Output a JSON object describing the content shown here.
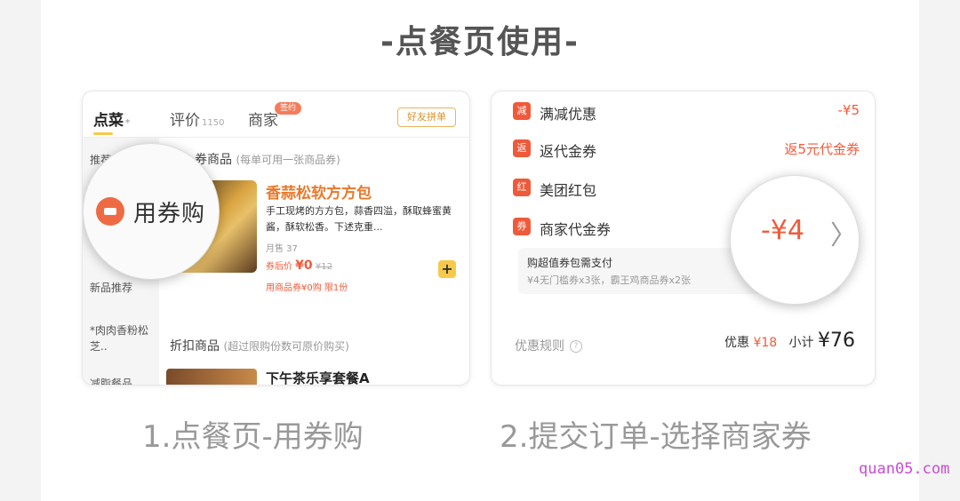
{
  "heading": "-点餐页使用-",
  "card1": {
    "tabs": [
      {
        "label": "点菜",
        "suffix": "*"
      },
      {
        "label": "评价",
        "count": "1150"
      },
      {
        "label": "商家",
        "badge": "签约"
      }
    ],
    "friend_button": "好友拼单",
    "sidebar": [
      "推荐",
      "新品推荐",
      "*肉肉香粉松芝..",
      "减脂餐品"
    ],
    "coupon_section": {
      "title": "券商品",
      "note": "(每单可用一张商品券)"
    },
    "magnifier_label": "用券购",
    "item": {
      "name": "香蒜松软方方包",
      "desc": "手工现烤的方方包，蒜香四溢，酥取蜂蜜黄酱，酥软松香。下述克重...",
      "sales": "月售 37",
      "price_label": "券后价",
      "price": "¥0",
      "orig_price": "¥12",
      "limit": "用商品券¥0购 限1份",
      "add": "+"
    },
    "discount_section": {
      "title": "折扣商品",
      "note": "(超过限购份数可原价购买)"
    },
    "item2_name": "下午茶乐享套餐A"
  },
  "card2": {
    "rows": [
      {
        "icon": "减",
        "label": "满减优惠",
        "value": "-¥5"
      },
      {
        "icon": "返",
        "label": "返代金券",
        "value": "返5元代金券"
      },
      {
        "icon": "红",
        "label": "美团红包",
        "value": ""
      },
      {
        "icon": "券",
        "label": "商家代金券",
        "value": ""
      }
    ],
    "combo_title": "购超值券包需支付",
    "combo_sub": "¥4无门槛券x3张，霸王鸡商品券x2张",
    "rules": "优惠规则",
    "help": "?",
    "discount_label": "优惠",
    "discount_value": "¥18",
    "subtotal_label": "小计",
    "subtotal_value": "¥76",
    "magnifier_value": "-¥4",
    "magnifier_chevron": "〉"
  },
  "captions": [
    "1.点餐页-用券购",
    "2.提交订单-选择商家券"
  ],
  "watermark": "quan05.com"
}
